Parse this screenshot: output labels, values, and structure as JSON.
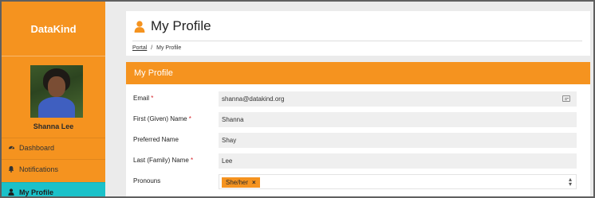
{
  "app": {
    "brand": "DataKind"
  },
  "user": {
    "name": "Shanna Lee"
  },
  "sidebar": {
    "items": [
      {
        "label": "Dashboard",
        "icon": "dashboard-icon"
      },
      {
        "label": "Notifications",
        "icon": "bell-icon"
      },
      {
        "label": "My Profile",
        "icon": "user-icon",
        "active": true
      }
    ]
  },
  "header": {
    "title": "My Profile",
    "breadcrumb": {
      "root": "Portal",
      "separator": "/",
      "current": "My Profile"
    }
  },
  "profile_card": {
    "title": "My Profile",
    "fields": {
      "email": {
        "label": "Email",
        "required_mark": "*",
        "value": "shanna@datakind.org"
      },
      "first_name": {
        "label": "First (Given) Name",
        "required_mark": "*",
        "value": "Shanna"
      },
      "preferred_name": {
        "label": "Preferred Name",
        "value": "Shay"
      },
      "last_name": {
        "label": "Last (Family) Name",
        "required_mark": "*",
        "value": "Lee"
      },
      "pronouns": {
        "label": "Pronouns",
        "selected": "She/her",
        "remove": "×"
      }
    }
  },
  "colors": {
    "accent": "#f5931f",
    "active_nav": "#1bc1c9",
    "required": "#d6232a"
  }
}
